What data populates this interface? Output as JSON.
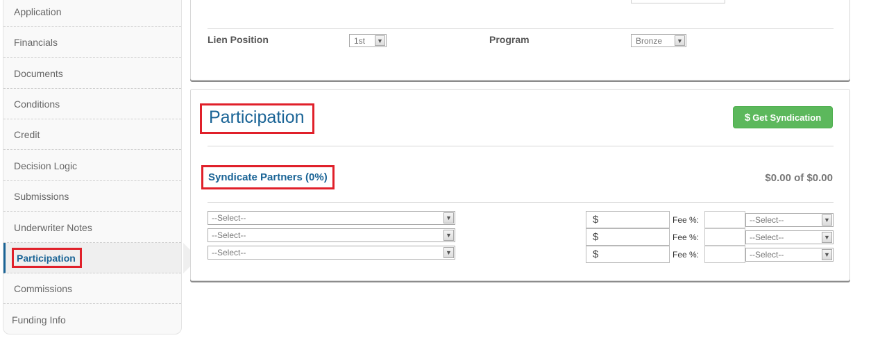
{
  "sidebar": {
    "items": [
      {
        "label": "Application"
      },
      {
        "label": "Financials"
      },
      {
        "label": "Documents"
      },
      {
        "label": "Conditions"
      },
      {
        "label": "Credit"
      },
      {
        "label": "Decision Logic"
      },
      {
        "label": "Submissions"
      },
      {
        "label": "Underwriter Notes"
      },
      {
        "label": "Participation",
        "active": true
      },
      {
        "label": "Commissions"
      },
      {
        "label": "Funding Info"
      }
    ]
  },
  "details": {
    "lien_position_label": "Lien Position",
    "lien_position_value": "1st",
    "program_label": "Program",
    "program_value": "Bronze"
  },
  "participation": {
    "title": "Participation",
    "get_syndication_label": "Get Syndication",
    "get_syndication_icon": "$",
    "syndicate_title": "Syndicate Partners (0%)",
    "amount_summary": "$0.00 of $0.00",
    "rows": [
      {
        "partner": "--Select--",
        "currency": "$",
        "fee_label": "Fee %:",
        "fee_type": "--Select--"
      },
      {
        "partner": "--Select--",
        "currency": "$",
        "fee_label": "Fee %:",
        "fee_type": "--Select--"
      },
      {
        "partner": "--Select--",
        "currency": "$",
        "fee_label": "Fee %:",
        "fee_type": "--Select--"
      }
    ]
  },
  "colors": {
    "accent_blue": "#1a6496",
    "success_green": "#5cb85c",
    "highlight_red": "#e0202a"
  }
}
